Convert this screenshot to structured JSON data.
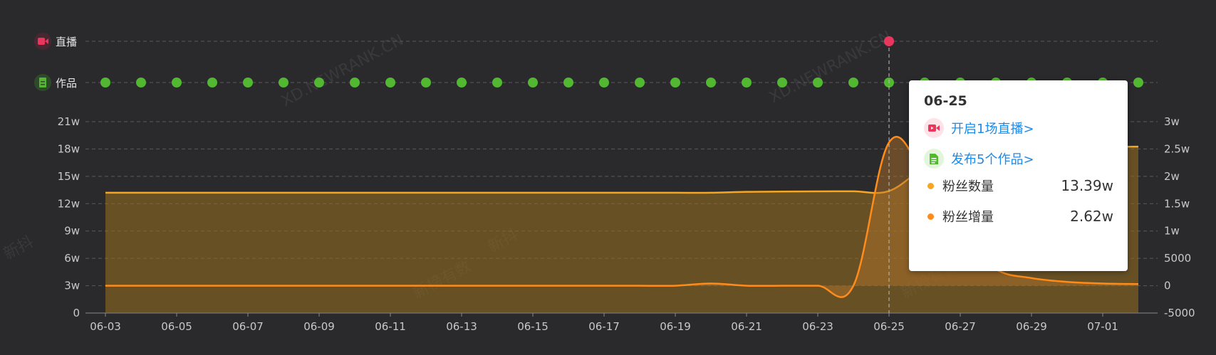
{
  "chart_data": {
    "type": "line",
    "categories": [
      "06-03",
      "06-04",
      "06-05",
      "06-06",
      "06-07",
      "06-08",
      "06-09",
      "06-10",
      "06-11",
      "06-12",
      "06-13",
      "06-14",
      "06-15",
      "06-16",
      "06-17",
      "06-18",
      "06-19",
      "06-20",
      "06-21",
      "06-22",
      "06-23",
      "06-24",
      "06-25",
      "06-26",
      "06-27",
      "06-28",
      "06-29",
      "06-30",
      "07-01",
      "07-02"
    ],
    "x_tick_labels": [
      "06-03",
      "06-05",
      "06-07",
      "06-09",
      "06-11",
      "06-13",
      "06-15",
      "06-17",
      "06-19",
      "06-21",
      "06-23",
      "06-25",
      "06-27",
      "06-29",
      "07-01"
    ],
    "y_left_ticks": [
      "0",
      "3w",
      "6w",
      "9w",
      "12w",
      "15w",
      "18w",
      "21w"
    ],
    "y_right_ticks": [
      "-5000",
      "0",
      "5000",
      "1w",
      "1.5w",
      "2w",
      "2.5w",
      "3w"
    ],
    "y_left_range": [
      0,
      210000
    ],
    "y_right_range": [
      -5000,
      30000
    ],
    "series": [
      {
        "name": "粉丝数量",
        "axis": "left",
        "color": "#f5a623",
        "values": [
          132000,
          132000,
          132000,
          132000,
          132000,
          132000,
          132000,
          132000,
          132000,
          132000,
          132000,
          132000,
          132000,
          132000,
          132000,
          132000,
          132000,
          132000,
          133000,
          133300,
          133500,
          133600,
          133900,
          160000,
          178000,
          181000,
          181500,
          182000,
          182300,
          182600
        ]
      },
      {
        "name": "粉丝增量",
        "axis": "right",
        "color": "#ff8c1a",
        "values": [
          0,
          0,
          0,
          0,
          0,
          0,
          0,
          0,
          0,
          0,
          0,
          0,
          0,
          0,
          0,
          0,
          0,
          400,
          0,
          0,
          0,
          0,
          26200,
          20000,
          9000,
          3000,
          1400,
          700,
          400,
          300
        ]
      }
    ],
    "events": {
      "live": {
        "label": "直播",
        "color": "#e8365d",
        "days": [
          "06-25"
        ]
      },
      "works": {
        "label": "作品",
        "color": "#52b832",
        "days": [
          "06-03",
          "06-04",
          "06-05",
          "06-06",
          "06-07",
          "06-08",
          "06-09",
          "06-10",
          "06-11",
          "06-12",
          "06-13",
          "06-14",
          "06-15",
          "06-16",
          "06-17",
          "06-18",
          "06-19",
          "06-20",
          "06-21",
          "06-22",
          "06-23",
          "06-24",
          "06-25",
          "06-26",
          "06-27",
          "06-28",
          "06-29",
          "06-30",
          "07-01",
          "07-02"
        ]
      }
    },
    "hover_date": "06-25"
  },
  "watermarks": [
    "XD.NEWRANK.CN",
    "XD.NEWRANK.CN",
    "新抖",
    "新榜有数",
    "新抖",
    "新榜有数"
  ],
  "tooltip": {
    "date": "06-25",
    "live_link": "开启1场直播>",
    "works_link": "发布5个作品>",
    "fans_count_label": "粉丝数量",
    "fans_count_value": "13.39w",
    "fans_count_color": "#f5a623",
    "fans_gain_label": "粉丝增量",
    "fans_gain_value": "2.62w",
    "fans_gain_color": "#ff8c1a",
    "live_icon": "video-camera-icon",
    "works_icon": "document-icon"
  }
}
